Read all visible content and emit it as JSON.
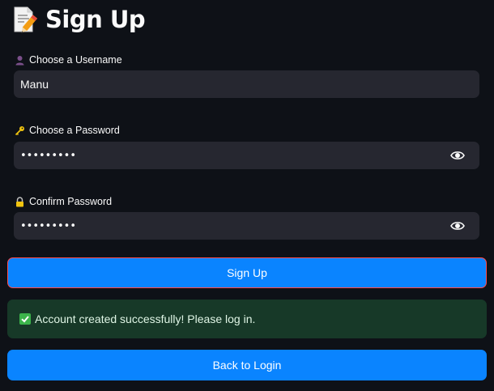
{
  "header": {
    "icon": "memo-pencil-icon",
    "title": "Sign Up"
  },
  "fields": {
    "username": {
      "icon": "person-icon",
      "label": "Choose a Username",
      "value": "Manu"
    },
    "password": {
      "icon": "key-icon",
      "label": "Choose a Password",
      "value": "•••••••••",
      "toggle_icon": "eye-icon"
    },
    "confirm": {
      "icon": "lock-icon",
      "label": "Confirm Password",
      "value": "•••••••••",
      "toggle_icon": "eye-icon"
    }
  },
  "buttons": {
    "signup_label": "Sign Up",
    "back_label": "Back to Login"
  },
  "alert": {
    "icon": "check-mark-icon",
    "text": "Account created successfully! Please log in.",
    "color": "#173928"
  },
  "colors": {
    "background": "#0e1117",
    "input_bg": "#262730",
    "primary": "#0a84ff",
    "signup_border": "#ff4b4b"
  }
}
